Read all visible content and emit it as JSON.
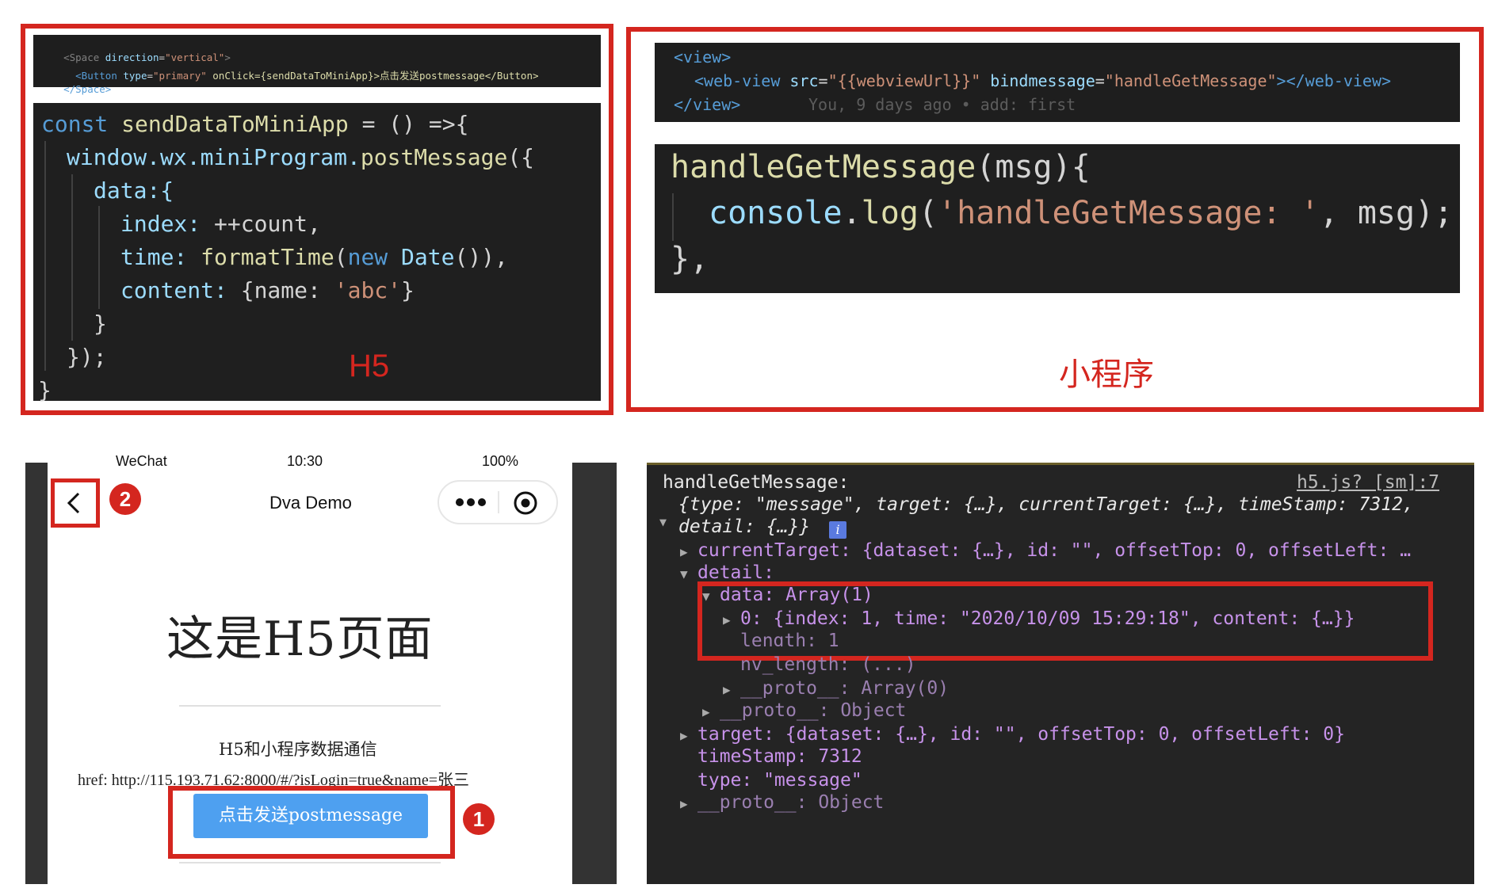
{
  "h5_panel": {
    "caption": "H5",
    "jsx_lines": [
      [
        "<Space",
        " direction",
        "=",
        "\"vertical\"",
        ">"
      ],
      [
        "  <Button",
        " type",
        "=",
        "\"primary\"",
        " onClick={sendDataToMiniApp}>点击发送postmessage</Button>"
      ],
      [
        "</Space>",
        "",
        "",
        "",
        ""
      ]
    ],
    "code": {
      "l1_kw": "const ",
      "l1_fn": "sendDataToMiniApp",
      "l1_rest": " = () =>{",
      "l2_obj": "window.wx.miniProgram.",
      "l2_fn": "postMessage",
      "l2_rest": "({",
      "l3": "data:{",
      "l4_key": "index: ",
      "l4_val": "++count,",
      "l5_key": "time: ",
      "l5_fn": "formatTime",
      "l5_p1": "(",
      "l5_new": "new ",
      "l5_date": "Date",
      "l5_end": "()),",
      "l6_key": "content: ",
      "l6_b1": "{name: ",
      "l6_str": "'abc'",
      "l6_b2": "}",
      "l7": "}",
      "l8": "});",
      "l9": "}"
    }
  },
  "mini_panel": {
    "caption": "小程序",
    "wxml": {
      "l1": "<view>",
      "l2_open": "<web-view ",
      "l2_src_attr": "src",
      "l2_src_val": "\"{{webviewUrl}}\"",
      "l2_bind_attr": " bindmessage",
      "l2_bind_val": "\"handleGetMessage\"",
      "l2_close": "></web-view>",
      "l3": "</view>",
      "l3_blame": "You, 9 days ago • add: first"
    },
    "js": {
      "l1_fn": "handleGetMessage",
      "l1_rest": "(msg){",
      "l2_obj": "console",
      "l2_dot": ".",
      "l2_fn": "log",
      "l2_p": "(",
      "l2_str": "'handleGetMessage: '",
      "l2_rest": ", msg);",
      "l3": "},"
    }
  },
  "phone": {
    "status_left": "WeChat",
    "status_mid": "10:30",
    "status_right": "100%",
    "nav_title": "Dva Demo",
    "marker_back": "2",
    "marker_button": "1",
    "heading": "这是H5页面",
    "subtitle": "H5和小程序数据通信",
    "href": "href: http://115.193.71.62:8000/#/?isLogin=true&name=张三",
    "button_label": "点击发送postmessage"
  },
  "console": {
    "header": "handleGetMessage:",
    "source": "h5.js? [sm]:7",
    "summary1": "{type: \"message\", target: {…}, currentTarget: {…}, timeStamp: 7312,",
    "summary2": "detail: {…}}",
    "info_badge": "i",
    "rows": {
      "currentTarget": "currentTarget: {dataset: {…}, id: \"\", offsetTop: 0, offsetLeft: …",
      "detail": "detail:",
      "data": "data: Array(1)",
      "item0": "0: {index: 1, time: \"2020/10/09 15:29:18\", content: {…}}",
      "length": "length: 1",
      "nv_length": "nv_length: (...)",
      "proto_array": "__proto__: Array(0)",
      "proto_obj1": "__proto__: Object",
      "target": "target: {dataset: {…}, id: \"\", offsetTop: 0, offsetLeft: 0}",
      "timeStamp": "timeStamp: 7312",
      "type": "type: \"message\"",
      "proto_obj2": "__proto__: Object"
    }
  },
  "colors": {
    "annotation_red": "#d4261f",
    "editor_bg": "#1f1f1f",
    "console_bg": "#242424",
    "button_blue": "#4ea0f0"
  }
}
